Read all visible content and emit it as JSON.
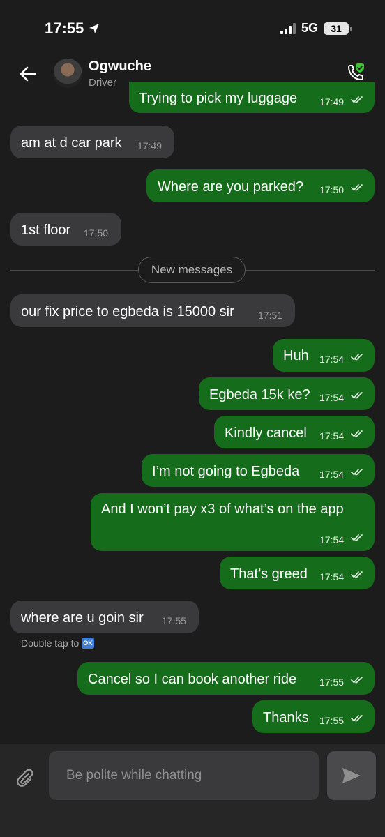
{
  "status": {
    "time": "17:55",
    "network": "5G",
    "battery": "31"
  },
  "header": {
    "name": "Ogwuche",
    "role": "Driver"
  },
  "messages": [
    {
      "dir": "out",
      "text": "Trying to pick my luggage",
      "time": "17:49"
    },
    {
      "dir": "in",
      "text": "am at d car park",
      "time": "17:49"
    },
    {
      "dir": "out",
      "text": "Where are you parked?",
      "time": "17:50"
    },
    {
      "dir": "in",
      "text": "1st floor",
      "time": "17:50"
    },
    {
      "dir": "in",
      "text": "our fix price to egbeda is 15000 sir",
      "time": "17:51"
    },
    {
      "dir": "out",
      "text": "Huh",
      "time": "17:54"
    },
    {
      "dir": "out",
      "text": "Egbeda 15k ke?",
      "time": "17:54"
    },
    {
      "dir": "out",
      "text": "Kindly cancel",
      "time": "17:54"
    },
    {
      "dir": "out",
      "text": "I’m not going to Egbeda",
      "time": "17:54"
    },
    {
      "dir": "out",
      "text": "And I won’t pay x3 of what’s on the app",
      "time": "17:54"
    },
    {
      "dir": "out",
      "text": "That’s greed",
      "time": "17:54"
    },
    {
      "dir": "in",
      "text": "where are u goin sir",
      "time": "17:55"
    },
    {
      "dir": "out",
      "text": "Cancel so I can book another ride",
      "time": "17:55"
    },
    {
      "dir": "out",
      "text": "Thanks",
      "time": "17:55"
    }
  ],
  "divider": {
    "label": "New messages"
  },
  "hint": {
    "text": "Double tap to",
    "emoji": "OK"
  },
  "composer": {
    "placeholder": "Be polite while chatting"
  },
  "colors": {
    "outgoing": "#156c1b",
    "incoming": "#3a3a3c",
    "background": "#1c1c1c",
    "shield": "#39c531"
  },
  "icons": [
    "location-arrow-icon",
    "signal-icon",
    "battery-icon",
    "back-arrow-icon",
    "phone-shield-icon",
    "double-check-icon",
    "paperclip-icon",
    "send-icon"
  ]
}
